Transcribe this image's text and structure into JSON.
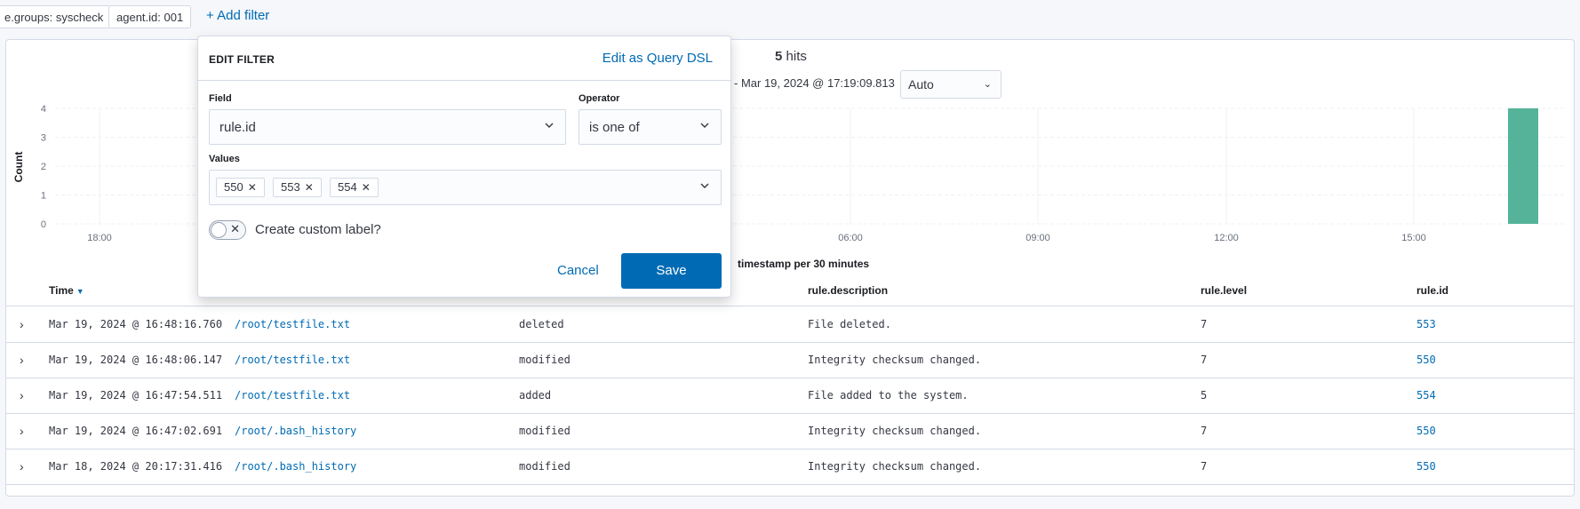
{
  "filters": {
    "pills": [
      "e.groups: syscheck",
      "agent.id: 001"
    ],
    "add_filter": "+ Add filter"
  },
  "summary": {
    "hits_count": "5",
    "hits_label": "hits",
    "date_range": "- Mar 19, 2024 @ 17:19:09.813",
    "interval_value": "Auto"
  },
  "chart_data": {
    "type": "bar",
    "ylabel": "Count",
    "xlabel": "timestamp per 30 minutes",
    "ylim": [
      0,
      4
    ],
    "yticks": [
      "0",
      "1",
      "2",
      "3",
      "4"
    ],
    "xticks": [
      "18:00",
      "06:00",
      "09:00",
      "12:00",
      "15:00"
    ],
    "bars": [
      {
        "x": "Mar 19, 2024 16:30",
        "value": 4
      }
    ],
    "grid": true,
    "colors": {
      "bar": "#54b399"
    }
  },
  "table": {
    "headers": {
      "time": "Time",
      "description": "rule.description",
      "level": "rule.level",
      "id": "rule.id"
    },
    "rows": [
      {
        "time": "Mar 19, 2024 @ 16:48:16.760",
        "path": "/root/testfile.txt",
        "event": "deleted",
        "description": "File deleted.",
        "level": "7",
        "id": "553"
      },
      {
        "time": "Mar 19, 2024 @ 16:48:06.147",
        "path": "/root/testfile.txt",
        "event": "modified",
        "description": "Integrity checksum changed.",
        "level": "7",
        "id": "550"
      },
      {
        "time": "Mar 19, 2024 @ 16:47:54.511",
        "path": "/root/testfile.txt",
        "event": "added",
        "description": "File added to the system.",
        "level": "5",
        "id": "554"
      },
      {
        "time": "Mar 19, 2024 @ 16:47:02.691",
        "path": "/root/.bash_history",
        "event": "modified",
        "description": "Integrity checksum changed.",
        "level": "7",
        "id": "550"
      },
      {
        "time": "Mar 18, 2024 @ 20:17:31.416",
        "path": "/root/.bash_history",
        "event": "modified",
        "description": "Integrity checksum changed.",
        "level": "7",
        "id": "550"
      }
    ]
  },
  "edit_filter": {
    "title": "EDIT FILTER",
    "query_dsl_link": "Edit as Query DSL",
    "field_label": "Field",
    "field_value": "rule.id",
    "operator_label": "Operator",
    "operator_value": "is one of",
    "values_label": "Values",
    "values": [
      "550",
      "553",
      "554"
    ],
    "custom_label_text": "Create custom label?",
    "custom_label_enabled": false,
    "cancel_label": "Cancel",
    "save_label": "Save"
  },
  "colors": {
    "accent": "#006bb4",
    "bar": "#54b399",
    "border": "#d3dae6"
  }
}
